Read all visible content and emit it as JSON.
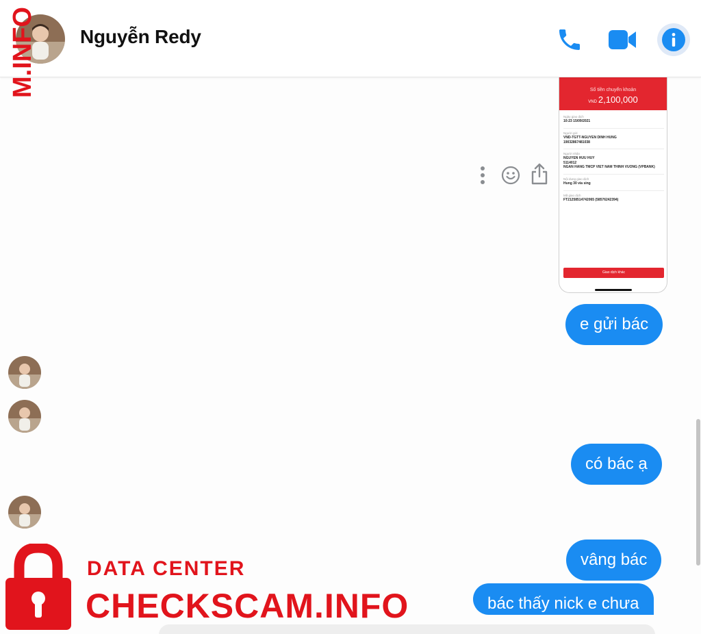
{
  "header": {
    "contact_name": "Nguyễn Redy",
    "icons": {
      "call": "phone-icon",
      "video": "video-camera-icon",
      "info": "info-icon"
    },
    "accent_color": "#1a8cf2"
  },
  "watermark": {
    "vertical_text": "M.INFO",
    "data_center": "DATA CENTER",
    "site": "CHECKSCAM.INFO",
    "color": "#e1141c"
  },
  "receipt": {
    "amount_label": "Số tiền chuyển khoản",
    "currency": "VND",
    "amount": "2,100,000",
    "rows": [
      {
        "label": "Ngày giao dịch",
        "value": "10:23 15/09/2021"
      },
      {
        "label": "Người gửi",
        "value": "VND-TGTT-NGUYEN DINH HUNG",
        "value2": "19032867481038"
      },
      {
        "label": "Người nhận",
        "value": "NGUYEN HUU HUY",
        "value2": "5114012",
        "value3": "NGAN HANG TMCP VIET NAM THINH VUONG (VPBANK)"
      },
      {
        "label": "Nội dung giao dịch",
        "value": "Hung 30 via sing"
      },
      {
        "label": "Mã giao dịch",
        "value": "FT21258514742065 (58576242394)"
      }
    ],
    "button": "Giao dịch khác"
  },
  "message_actions": {
    "more": "more-vertical-icon",
    "react": "smiley-icon",
    "share": "share-icon"
  },
  "messages": [
    {
      "text": "e gửi bác"
    },
    {
      "text": "có bác ạ"
    },
    {
      "text": "vâng bác"
    },
    {
      "text": "bác thấy nick e chưa"
    }
  ]
}
